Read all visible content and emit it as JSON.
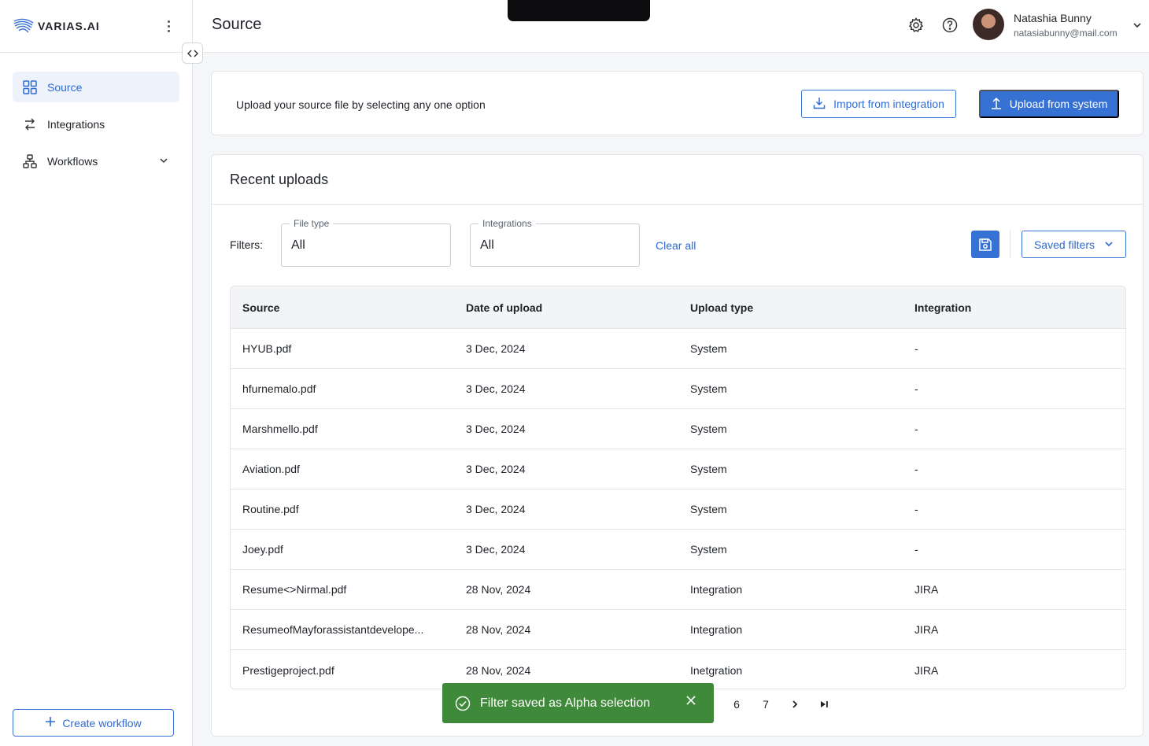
{
  "app": {
    "logo_text": "VARIAS.AI",
    "brand_color": "#3671d4"
  },
  "sidebar": {
    "items": [
      {
        "label": "Source",
        "icon": "grid-icon",
        "active": true
      },
      {
        "label": "Integrations",
        "icon": "arrows-exchange-icon",
        "active": false
      },
      {
        "label": "Workflows",
        "icon": "workflow-icon",
        "active": false,
        "expandable": true
      }
    ],
    "create_label": "Create workflow"
  },
  "header": {
    "title": "Source",
    "user": {
      "name": "Natashia Bunny",
      "email": "natasiabunny@mail.com"
    }
  },
  "upload": {
    "prompt": "Upload your source file by selecting any one option",
    "import_label": "Import from integration",
    "upload_label": "Upload from system"
  },
  "recent": {
    "title": "Recent uploads",
    "filters_label": "Filters:",
    "file_type": {
      "legend": "File type",
      "value": "All"
    },
    "integrations": {
      "legend": "Integrations",
      "value": "All"
    },
    "clear_all": "Clear all",
    "saved_filters": "Saved filters",
    "columns": [
      "Source",
      "Date of upload",
      "Upload type",
      "Integration"
    ],
    "rows": [
      [
        "HYUB.pdf",
        "3 Dec, 2024",
        "System",
        "-"
      ],
      [
        "hfurnemalo.pdf",
        "3 Dec, 2024",
        "System",
        "-"
      ],
      [
        "Marshmello.pdf",
        "3 Dec, 2024",
        "System",
        "-"
      ],
      [
        "Aviation.pdf",
        "3 Dec, 2024",
        "System",
        "-"
      ],
      [
        "Routine.pdf",
        "3 Dec, 2024",
        "System",
        "-"
      ],
      [
        "Joey.pdf",
        "3 Dec, 2024",
        "System",
        "-"
      ],
      [
        "Resume<>Nirmal.pdf",
        "28 Nov, 2024",
        "Integration",
        "JIRA"
      ],
      [
        "ResumeofMayforassistantdevelope...",
        "28 Nov, 2024",
        "Integration",
        "JIRA"
      ],
      [
        "Prestigeproject.pdf",
        "28 Nov, 2024",
        "Inetgration",
        "JIRA"
      ]
    ],
    "pagination": {
      "pages": [
        "6",
        "7"
      ],
      "next": "›",
      "last": "⏭"
    }
  },
  "toast": {
    "message": "Filter saved as Alpha selection",
    "color": "#3f8a3a"
  }
}
